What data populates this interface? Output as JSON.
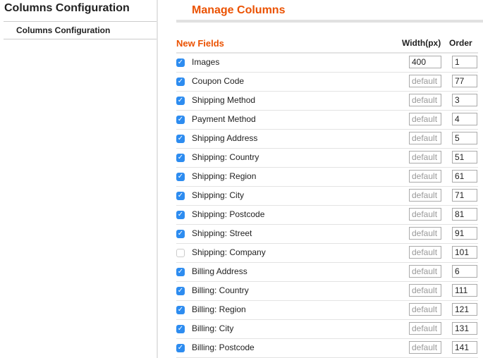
{
  "sidebar": {
    "title": "Columns Configuration",
    "items": [
      {
        "label": "Columns Configuration"
      }
    ]
  },
  "main": {
    "title": "Manage Columns",
    "table": {
      "headers": {
        "fields": "New Fields",
        "width": "Width(px)",
        "order": "Order"
      },
      "width_placeholder": "default",
      "rows": [
        {
          "label": "Images",
          "checked": true,
          "width": "400",
          "order": "1"
        },
        {
          "label": "Coupon Code",
          "checked": true,
          "width": "",
          "order": "77"
        },
        {
          "label": "Shipping Method",
          "checked": true,
          "width": "",
          "order": "3"
        },
        {
          "label": "Payment Method",
          "checked": true,
          "width": "",
          "order": "4"
        },
        {
          "label": "Shipping Address",
          "checked": true,
          "width": "",
          "order": "5"
        },
        {
          "label": "Shipping: Country",
          "checked": true,
          "width": "",
          "order": "51"
        },
        {
          "label": "Shipping: Region",
          "checked": true,
          "width": "",
          "order": "61"
        },
        {
          "label": "Shipping: City",
          "checked": true,
          "width": "",
          "order": "71"
        },
        {
          "label": "Shipping: Postcode",
          "checked": true,
          "width": "",
          "order": "81"
        },
        {
          "label": "Shipping: Street",
          "checked": true,
          "width": "",
          "order": "91"
        },
        {
          "label": "Shipping: Company",
          "checked": false,
          "width": "",
          "order": "101"
        },
        {
          "label": "Billing Address",
          "checked": true,
          "width": "",
          "order": "6"
        },
        {
          "label": "Billing: Country",
          "checked": true,
          "width": "",
          "order": "111"
        },
        {
          "label": "Billing: Region",
          "checked": true,
          "width": "",
          "order": "121"
        },
        {
          "label": "Billing: City",
          "checked": true,
          "width": "",
          "order": "131"
        },
        {
          "label": "Billing: Postcode",
          "checked": true,
          "width": "",
          "order": "141"
        }
      ]
    }
  },
  "colors": {
    "accent": "#eb5202",
    "checkbox": "#2d8cf0"
  }
}
